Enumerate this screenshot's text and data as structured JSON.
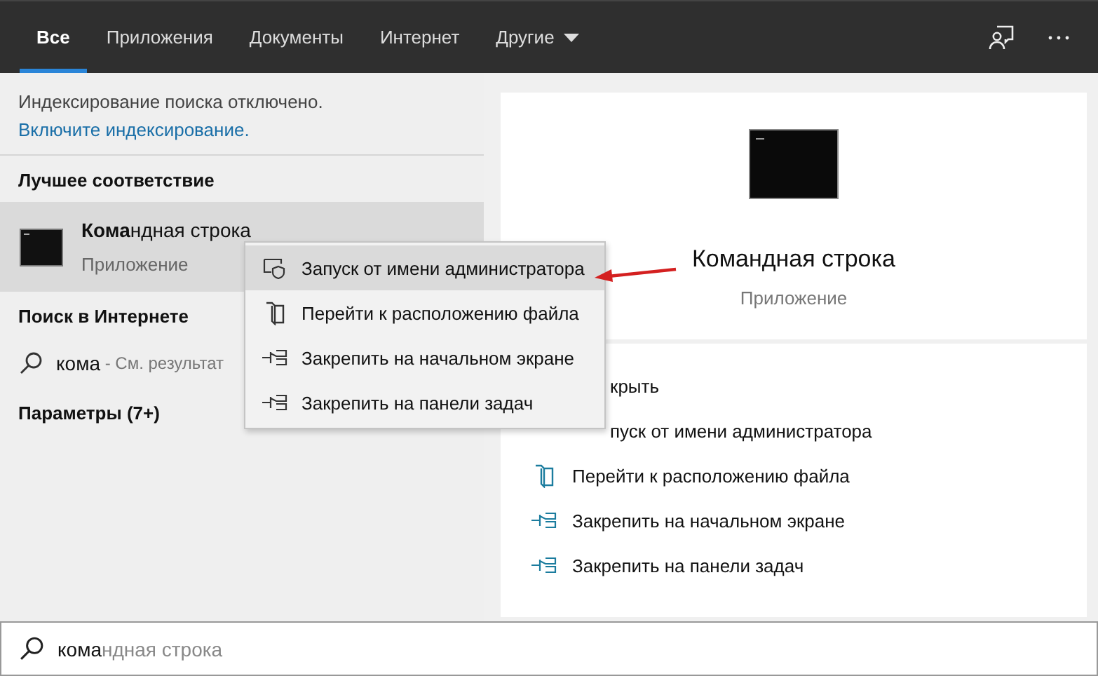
{
  "tabs": [
    {
      "label": "Все",
      "selected": true,
      "dropdown": false
    },
    {
      "label": "Приложения",
      "selected": false,
      "dropdown": false
    },
    {
      "label": "Документы",
      "selected": false,
      "dropdown": false
    },
    {
      "label": "Интернет",
      "selected": false,
      "dropdown": false
    },
    {
      "label": "Другие",
      "selected": false,
      "dropdown": true
    }
  ],
  "left": {
    "notice": "Индексирование поиска отключено.",
    "notice_link": "Включите индексирование.",
    "best_match_heading": "Лучшее соответствие",
    "best_match": {
      "title": "**Кома**ндная строка",
      "subtitle": "Приложение",
      "selected": true
    },
    "web_heading": "Поиск в Интернете",
    "web_result": {
      "query": "кома",
      "hint": " - См. результат"
    },
    "settings_heading": "Параметры (7+)"
  },
  "context_menu": [
    {
      "label": "Запуск от имени администратора",
      "kind": "shield",
      "selected": true
    },
    {
      "label": "Перейти к расположению файла",
      "kind": "folder",
      "selected": false
    },
    {
      "label": "Закрепить на начальном экране",
      "kind": "pin",
      "selected": false
    },
    {
      "label": "Закрепить на панели задач",
      "kind": "pin",
      "selected": false
    }
  ],
  "preview": {
    "title": "Командная строка",
    "subtitle": "Приложение"
  },
  "actions": [
    {
      "label": "крыть",
      "kind": "covered"
    },
    {
      "label": "пуск от имени администратора",
      "kind": "covered"
    },
    {
      "label": "Перейти к расположению файла",
      "kind": "folder"
    },
    {
      "label": "Закрепить на начальном экране",
      "kind": "pin"
    },
    {
      "label": "Закрепить на панели задач",
      "kind": "pin"
    }
  ],
  "search": {
    "typed": "кома",
    "suggestion": "ндная строка"
  }
}
